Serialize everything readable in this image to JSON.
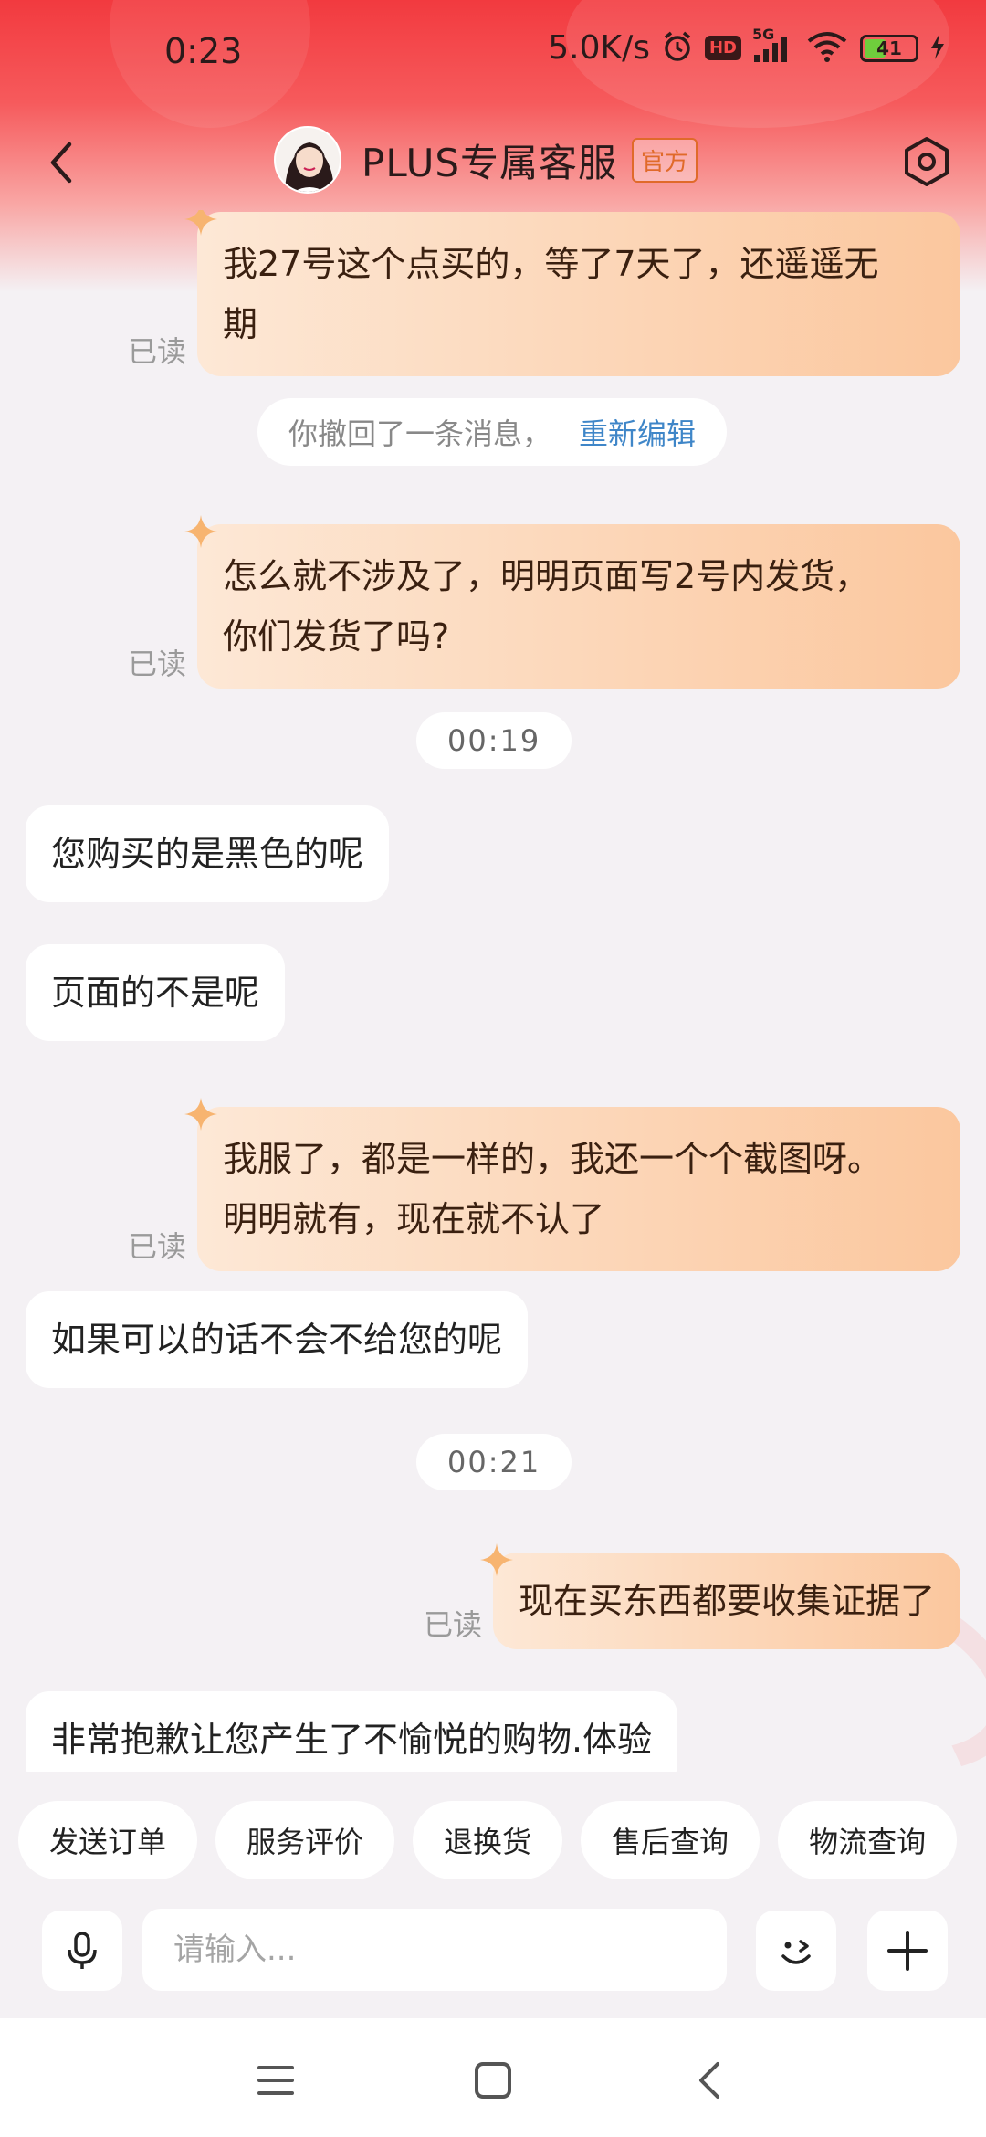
{
  "status_bar": {
    "time": "0:23",
    "net_speed": "5.0K/s",
    "hd": "HD",
    "signal": "5G",
    "battery": "41"
  },
  "header": {
    "title": "PLUS专属客服",
    "badge": "官方"
  },
  "messages": {
    "m1": {
      "line1": "我27号这个点买的，等了7天了，还遥遥无",
      "line2": "期",
      "read": "已读"
    },
    "recall": {
      "text": "你撤回了一条消息，",
      "link": "重新编辑"
    },
    "m2": {
      "line1": "怎么就不涉及了，明明页面写2号内发货，",
      "line2": "你们发货了吗?",
      "read": "已读"
    },
    "time1": "00:19",
    "m3": "您购买的是黑色的呢",
    "m4": "页面的不是呢",
    "m5": {
      "line1": "我服了，都是一样的，我还一个个截图呀。",
      "line2": "明明就有，现在就不认了",
      "read": "已读"
    },
    "m6": "如果可以的话不会不给您的呢",
    "time2": "00:21",
    "m7": {
      "text": "现在买东西都要收集证据了",
      "read": "已读"
    },
    "m8": "非常抱歉让您产生了不愉悦的购物.体验"
  },
  "quick_replies": [
    "发送订单",
    "服务评价",
    "退换货",
    "售后查询",
    "物流查询"
  ],
  "input": {
    "placeholder": "请输入..."
  },
  "colors": {
    "header_red": "#f23a3f",
    "bubble_out_start": "#fde8d6",
    "bubble_out_end": "#fbc79e",
    "link_blue": "#3f86c8",
    "badge_orange": "#e06a2a"
  },
  "icons": {
    "back": "chevron-left-icon",
    "settings": "hexagon-settings-icon",
    "mic": "microphone-icon",
    "emoji": "wink-face-icon",
    "plus": "plus-icon",
    "nav_menu": "menu-lines-icon",
    "nav_home": "square-home-icon",
    "nav_back": "chevron-left-icon"
  }
}
